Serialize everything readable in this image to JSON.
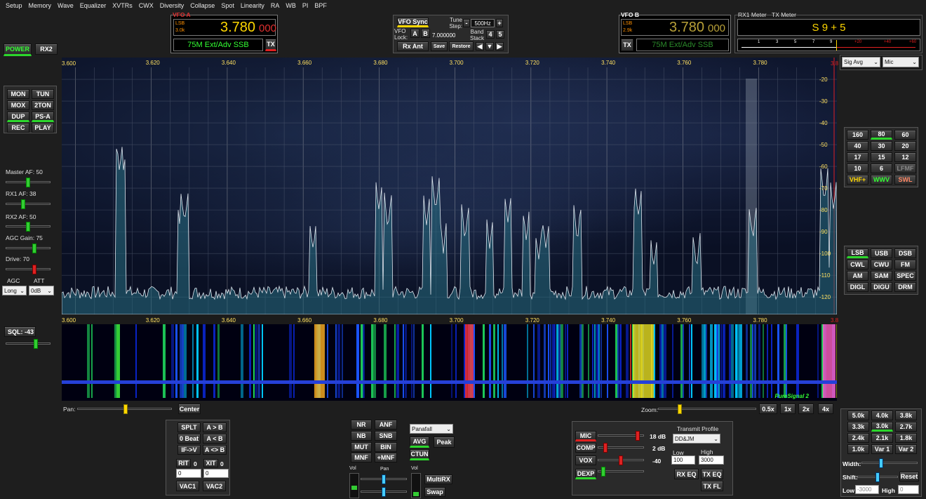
{
  "menu": [
    "Setup",
    "Memory",
    "Wave",
    "Equalizer",
    "XVTRs",
    "CWX",
    "Diversity",
    "Collapse",
    "Spot",
    "Linearity",
    "RA",
    "WB",
    "PI",
    "BPF"
  ],
  "left": {
    "power": "POWER",
    "rx2": "RX2",
    "mon": "MON",
    "tun": "TUN",
    "mox": "MOX",
    "twoton": "2TON",
    "dup": "DUP",
    "psa": "PS-A",
    "rec": "REC",
    "play": "PLAY",
    "master_af": "Master AF:  50",
    "rx1_af": "RX1 AF:  38",
    "rx2_af": "RX2 AF:  50",
    "agc_gain": "AGC Gain:  75",
    "drive": "Drive:  70",
    "agc": "AGC",
    "att": "ATT",
    "agc_val": "Long",
    "att_val": "0dB",
    "sql": "SQL: -43"
  },
  "vfoa": {
    "title": "VFO A",
    "mode": "LSB",
    "bw": "3.0k",
    "freq": "3.780",
    "freq_sub": "000",
    "band": "75M Ext/Adv SSB",
    "tx": "TX"
  },
  "vfob": {
    "title": "VFO B",
    "mode": "LSB",
    "bw": "2.9k",
    "freq": "3.780",
    "freq_sub": "000",
    "band": "75M Ext/Adv SSB",
    "tx": "TX"
  },
  "center": {
    "vfo_sync": "VFO Sync",
    "vfo_lock": "VFO Lock:",
    "a": "A",
    "b": "B",
    "lock_val": "7.000000",
    "rx_ant": "Rx Ant",
    "save": "Save",
    "restore": "Restore",
    "tune_step": "Tune Step:",
    "step_val": "500Hz",
    "minus": "-",
    "plus": "+",
    "band_stack": "Band Stack",
    "bs4": "4",
    "bs5": "5"
  },
  "meter": {
    "rx1": "RX1 Meter",
    "tx": "TX Meter",
    "reading": "S 9 + 5",
    "scale": [
      "1",
      "3",
      "5",
      "7",
      "9",
      "+20",
      "+40",
      "+60"
    ],
    "sig": "Sig Avg",
    "src": "Mic"
  },
  "spectrum": {
    "freqs": [
      "3.600",
      "3.620",
      "3.640",
      "3.660",
      "3.680",
      "3.700",
      "3.720",
      "3.740",
      "3.760",
      "3.780"
    ],
    "db": [
      "-20",
      "-30",
      "-40",
      "-50",
      "-60",
      "-70",
      "-80",
      "-90",
      "-100",
      "-110",
      "-120"
    ],
    "pure": "PureSignal 2",
    "edge": "3.8"
  },
  "bands": [
    "160",
    "80",
    "60",
    "40",
    "30",
    "20",
    "17",
    "15",
    "12",
    "10",
    "6",
    "LFMF",
    "VHF+",
    "WWV",
    "SWL"
  ],
  "modes": [
    "LSB",
    "USB",
    "DSB",
    "CWL",
    "CWU",
    "FM",
    "AM",
    "SAM",
    "SPEC",
    "DIGL",
    "DIGU",
    "DRM"
  ],
  "filters": [
    "5.0k",
    "4.0k",
    "3.8k",
    "3.3k",
    "3.0k",
    "2.7k",
    "2.4k",
    "2.1k",
    "1.8k",
    "1.0k",
    "Var 1",
    "Var 2"
  ],
  "filt": {
    "width": "Width:",
    "shift": "Shift:",
    "reset": "Reset",
    "low": "Low",
    "low_val": "-3000",
    "high": "High",
    "high_val": "0"
  },
  "pan": {
    "pan": "Pan:",
    "center": "Center",
    "zoom": "Zoom:",
    "z05": "0.5x",
    "z1": "1x",
    "z2": "2x",
    "z4": "4x"
  },
  "bottom": {
    "splt": "SPLT",
    "a2b": "A > B",
    "zbeat": "0 Beat",
    "b2a": "A < B",
    "ifv": "IF->V",
    "swap_ab": "A <> B",
    "rit": "RIT",
    "rit_v": "0",
    "xit": "XIT",
    "xit_v": "0",
    "rit_spin": "0",
    "xit_spin": "0",
    "vac1": "VAC1",
    "vac2": "VAC2",
    "nr": "NR",
    "anf": "ANF",
    "nb": "NB",
    "snb": "SNB",
    "mut": "MUT",
    "bin": "BIN",
    "mnf": "MNF",
    "pmnf": "+MNF",
    "display": "Panafall",
    "avg": "AVG",
    "peak": "Peak",
    "ctun": "CTUN",
    "vol": "Vol",
    "panl": "Pan",
    "vol2": "Vol",
    "multirx": "MultiRX",
    "swap": "Swap"
  },
  "tx": {
    "mic": "MIC",
    "comp": "COMP",
    "vox": "VOX",
    "dexp": "DEXP",
    "mic_db": "18 dB",
    "comp_db": "2 dB",
    "vox_db": "-40",
    "profile": "Transmit Profile",
    "profile_val": "DD&JM",
    "low": "Low",
    "high": "High",
    "low_v": "100",
    "high_v": "3000",
    "rxeq": "RX EQ",
    "txeq": "TX EQ",
    "txfl": "TX FL"
  }
}
